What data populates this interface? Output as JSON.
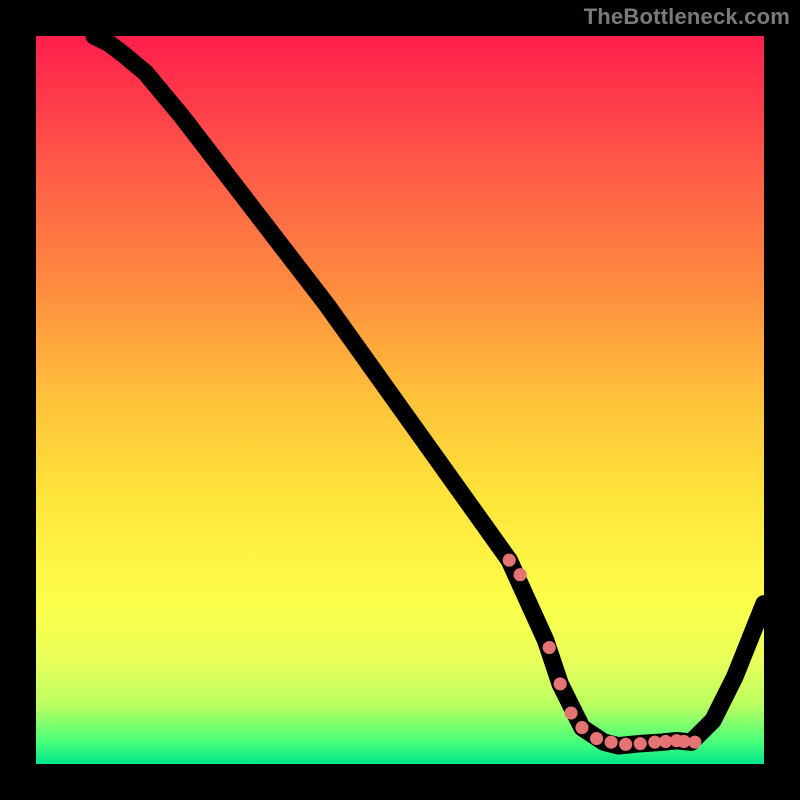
{
  "attribution": "TheBottleneck.com",
  "colors": {
    "frame": "#000000",
    "gradient_top": "#ff1e4c",
    "gradient_bottom": "#00e58a",
    "curve": "#000000",
    "marker": "#e57373"
  },
  "chart_data": {
    "type": "line",
    "title": "",
    "xlabel": "",
    "ylabel": "",
    "xlim": [
      0,
      100
    ],
    "ylim": [
      0,
      100
    ],
    "series": [
      {
        "name": "curve",
        "x": [
          8,
          10,
          12,
          15,
          20,
          30,
          40,
          50,
          60,
          65,
          70,
          72,
          75,
          78,
          80,
          83,
          86,
          88,
          90,
          93,
          96,
          100
        ],
        "y": [
          100,
          99,
          97.5,
          95,
          89,
          76,
          63,
          49,
          35,
          28,
          17,
          11,
          5,
          3,
          2.5,
          2.8,
          3,
          3.2,
          3,
          6,
          12,
          22
        ]
      }
    ],
    "markers": {
      "name": "highlighted-points",
      "color": "#e57373",
      "x": [
        65,
        66.5,
        70.5,
        72,
        73.5,
        75,
        77,
        79,
        81,
        83,
        85,
        86.5,
        88,
        89,
        90.5
      ],
      "y": [
        28,
        26,
        16,
        11,
        7,
        5,
        3.5,
        3,
        2.7,
        2.8,
        3,
        3.1,
        3.2,
        3.1,
        3
      ]
    }
  }
}
